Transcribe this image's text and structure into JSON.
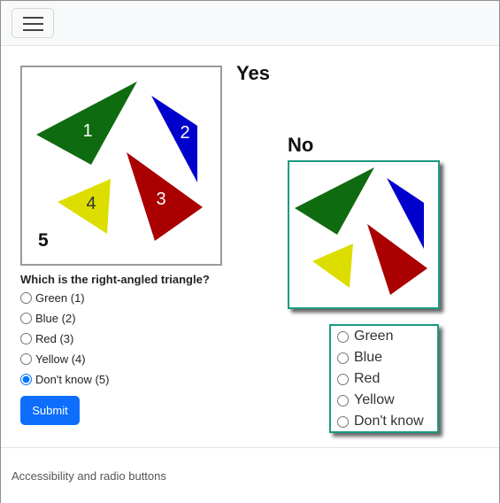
{
  "question": "Which is the right-angled triangle?",
  "image_labels": {
    "t1": "1",
    "t2": "2",
    "t3": "3",
    "t4": "4",
    "corner": "5"
  },
  "captions": {
    "yes": "Yes",
    "no": "No"
  },
  "options": [
    "Green (1)",
    "Blue (2)",
    "Red (3)",
    "Yellow (4)",
    "Don't know (5)"
  ],
  "selected_option": "Don't know (5)",
  "submit_label": "Submit",
  "options_plain": [
    "Green",
    "Blue",
    "Red",
    "Yellow",
    "Don't know"
  ],
  "footer": "Accessibility and radio buttons",
  "colors": {
    "green": "#0f6b0f",
    "blue": "#0000cc",
    "red": "#aa0000",
    "yellow": "#dddd00",
    "accent": "#0d6efd",
    "frame": "#1c9a82"
  },
  "icons": {
    "menu": "hamburger-menu-icon"
  }
}
